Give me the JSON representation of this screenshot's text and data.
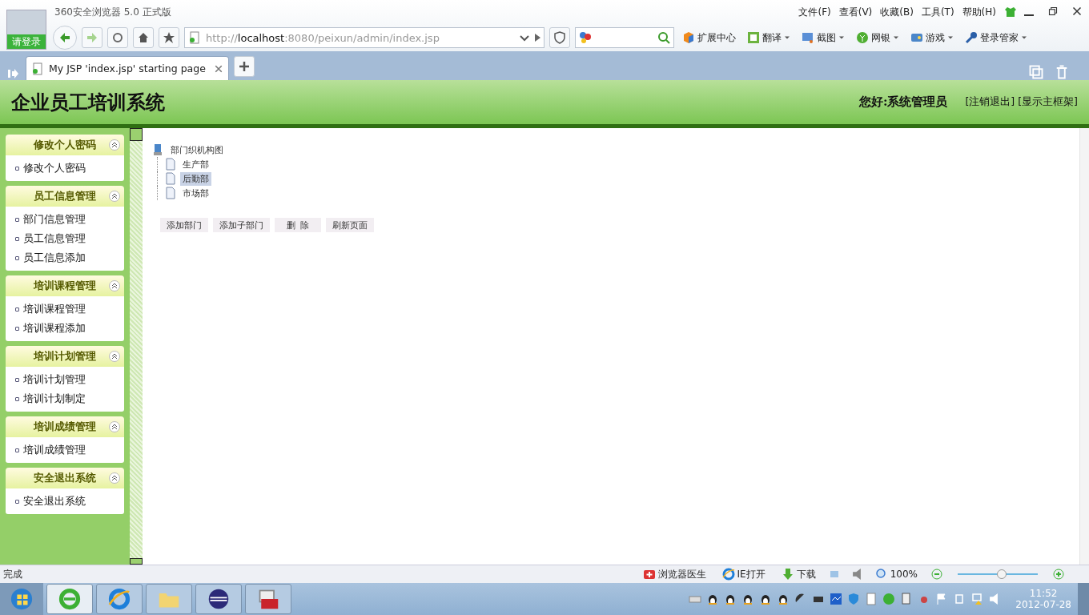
{
  "browser": {
    "title": "360安全浏览器 5.0 正式版",
    "login": "请登录",
    "menu": [
      "文件(F)",
      "查看(V)",
      "收藏(B)",
      "工具(T)",
      "帮助(H)"
    ],
    "url": {
      "scheme": "http://",
      "host": "localhost",
      "rest": ":8080/peixun/admin/index.jsp"
    },
    "tools": [
      {
        "label": "扩展中心",
        "kind": "cube",
        "dropdown": false
      },
      {
        "label": "翻译",
        "kind": "translate",
        "dropdown": true
      },
      {
        "label": "截图",
        "kind": "screenshot",
        "dropdown": true
      },
      {
        "label": "网银",
        "kind": "coin",
        "dropdown": true
      },
      {
        "label": "游戏",
        "kind": "game",
        "dropdown": true
      },
      {
        "label": "登录管家",
        "kind": "key",
        "dropdown": true
      }
    ],
    "tabs": [
      {
        "label": "My JSP 'index.jsp' starting page",
        "selected": true
      }
    ]
  },
  "header": {
    "title": "企业员工培训系统",
    "greeting": "您好:系统管理员",
    "links": [
      "[注销退出]",
      "[显示主框架]"
    ]
  },
  "sidebar": [
    {
      "title": "修改个人密码",
      "expanded": true,
      "items": [
        "修改个人密码"
      ]
    },
    {
      "title": "员工信息管理",
      "expanded": true,
      "items": [
        "部门信息管理",
        "员工信息管理",
        "员工信息添加"
      ]
    },
    {
      "title": "培训课程管理",
      "expanded": true,
      "items": [
        "培训课程管理",
        "培训课程添加"
      ]
    },
    {
      "title": "培训计划管理",
      "expanded": true,
      "items": [
        "培训计划管理",
        "培训计划制定"
      ]
    },
    {
      "title": "培训成绩管理",
      "expanded": true,
      "items": [
        "培训成绩管理"
      ]
    },
    {
      "title": "安全退出系统",
      "expanded": true,
      "items": [
        "安全退出系统"
      ]
    }
  ],
  "tree": {
    "label": "部门织机构图",
    "children": [
      {
        "label": "生产部",
        "selected": false
      },
      {
        "label": "后勤部",
        "selected": true
      },
      {
        "label": "市场部",
        "selected": false
      }
    ]
  },
  "actions": [
    "添加部门",
    "添加子部门",
    "删  除",
    "刷新页面"
  ],
  "status_bar": {
    "text": "完成",
    "items": [
      {
        "label": "浏览器医生",
        "kind": "doctor"
      },
      {
        "label": "IE打开",
        "kind": "ie"
      },
      {
        "label": "下载",
        "kind": "download"
      }
    ],
    "zoom": "100%",
    "zoom_level": {
      "level": 0.55
    }
  },
  "taskbar": {
    "apps": [
      {
        "kind": "browser360",
        "selected": true
      },
      {
        "kind": "ie",
        "selected": false
      },
      {
        "kind": "folder",
        "selected": false
      },
      {
        "kind": "eclipse",
        "selected": false
      },
      {
        "kind": "toolbox",
        "selected": false
      }
    ],
    "time": "11:52",
    "date": "2012-07-28"
  }
}
